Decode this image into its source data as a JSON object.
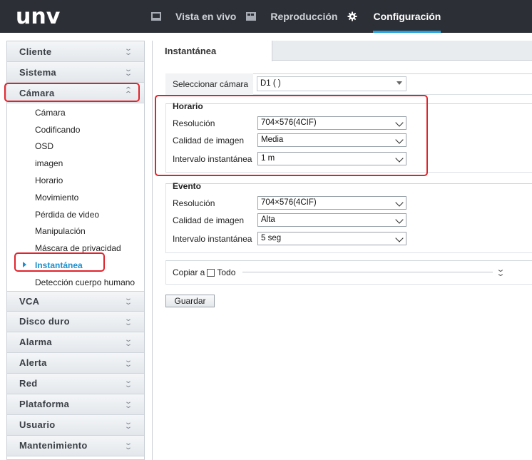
{
  "header": {
    "logo": "unv",
    "nav": [
      {
        "label": "Vista en vivo",
        "icon": "monitor-icon"
      },
      {
        "label": "Reproducción",
        "icon": "playback-icon"
      },
      {
        "label": "Configuración",
        "icon": "gear-icon",
        "active": true
      }
    ]
  },
  "sidebar": {
    "sections_top": [
      "Cliente",
      "Sistema"
    ],
    "expanded_section": "Cámara",
    "items": [
      "Cámara",
      "Codificando",
      "OSD",
      "imagen",
      "Horario",
      "Movimiento",
      "Pérdida de video",
      "Manipulación",
      "Máscara de privacidad",
      "Instantánea",
      "Detección cuerpo humano"
    ],
    "active_item": "Instantánea",
    "sections_bottom": [
      "VCA",
      "Disco duro",
      "Alarma",
      "Alerta",
      "Red",
      "Plataforma",
      "Usuario",
      "Mantenimiento"
    ]
  },
  "main": {
    "tab": "Instantánea",
    "camera": {
      "label": "Seleccionar cámara",
      "value": "D1 ( )"
    },
    "horario": {
      "title": "Horario",
      "resolution": {
        "label": "Resolución",
        "value": "704×576(4CIF)"
      },
      "quality": {
        "label": "Calidad de imagen",
        "value": "Media"
      },
      "interval": {
        "label": "Intervalo instantánea",
        "value": "1 m"
      }
    },
    "evento": {
      "title": "Evento",
      "resolution": {
        "label": "Resolución",
        "value": "704×576(4CIF)"
      },
      "quality": {
        "label": "Calidad de imagen",
        "value": "Alta"
      },
      "interval": {
        "label": "Intervalo instantánea",
        "value": "5 seg"
      }
    },
    "copy": {
      "label": "Copiar a",
      "all": "Todo",
      "checked": false
    },
    "save": "Guardar"
  },
  "colors": {
    "topbar": "#2c2f36",
    "accent": "#1fa3e0",
    "active_item": "#1b8fd0",
    "highlight": "#e0232b"
  }
}
